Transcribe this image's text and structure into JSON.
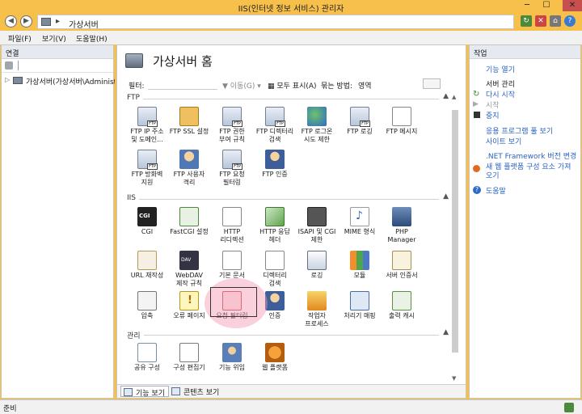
{
  "window": {
    "title": "IIS(인터넷 정보 서비스) 관리자",
    "min": "─",
    "max": "☐",
    "close": "✕"
  },
  "address": {
    "separator": "▸",
    "path": "가상서버",
    "suffix": "▸"
  },
  "menu": {
    "file": "파일(F)",
    "view": "보기(V)",
    "help": "도움말(H)"
  },
  "left_pane": {
    "header": "연결",
    "tree_item": "가상서버(가상서버\\Administ"
  },
  "page": {
    "title": "가상서버 홈",
    "filter_label": "필터:",
    "go_label": "이동(G)",
    "show_all_label": "모두 표시(A)",
    "group_by_label": "묶는 방법:",
    "group_by_value": "영역"
  },
  "sections": {
    "ftp": "FTP",
    "iis": "IIS",
    "management": "관리"
  },
  "features": {
    "ftp_ip": "FTP IP 주소\n및 도메인...",
    "ftp_ssl": "FTP SSL 설정",
    "ftp_auth_rules": "FTP 권한\n부여 규칙",
    "ftp_dir_browse": "FTP 디렉터리\n검색",
    "ftp_logon": "FTP 로그온\n시도 제한",
    "ftp_log": "FTP 로깅",
    "ftp_msg": "FTP 메시지",
    "ftp_firewall": "FTP 방화벽\n지원",
    "ftp_user_iso": "FTP 사용자\n격리",
    "ftp_req_filter": "FTP 요청\n필터링",
    "ftp_authn": "FTP 인증",
    "cgi": "CGI",
    "fastcgi": "FastCGI 설정",
    "http_redirect": "HTTP\n리디렉션",
    "http_headers": "HTTP 응답\n헤더",
    "isapi_cgi": "ISAPI 및 CGI\n제한",
    "mime": "MIME 형식",
    "php": "PHP\nManager",
    "url_rewrite": "URL 재작성",
    "webdav": "WebDAV\n제작 규칙",
    "default_doc": "기본 문서",
    "dir_browse": "디렉터리\n검색",
    "logging": "로깅",
    "modules": "모듈",
    "server_cert": "서버 인증서",
    "compression": "압축",
    "error_pages": "오류 페이지",
    "request_filter": "요청 필터링",
    "authentication": "인증",
    "worker_proc": "작업자\n프로세스",
    "handler": "처리기 매핑",
    "output_cache": "출력 캐시",
    "shared_config": "공유 구성",
    "config_editor": "구성 편집기",
    "delegation": "기능 위임",
    "web_platform": "웹 플랫폼"
  },
  "bottom_tabs": {
    "features_view": "기능 보기",
    "content_view": "콘텐츠 보기"
  },
  "actions": {
    "header": "작업",
    "open_feature": "기능 열기",
    "manage_server": "서버 관리",
    "restart": "다시 시작",
    "start": "시작",
    "stop": "중지",
    "app_pools": "응용 프로그램 풀 보기",
    "sites": "사이트 보기",
    "dotnet": ".NET Framework 버전 변경",
    "new_platform": "새 웹 플랫폼 구성 요소 가져오기",
    "help": "도움말"
  },
  "status": {
    "text": "준비"
  }
}
